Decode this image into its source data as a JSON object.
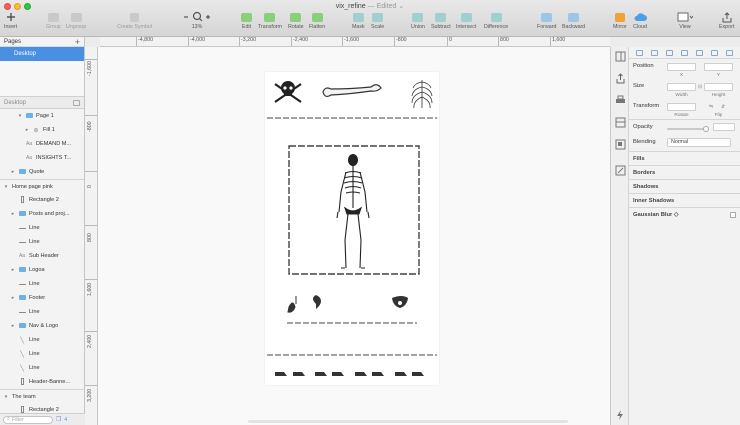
{
  "window": {
    "title": "vix_refine",
    "title_suffix": "— Edited ⌄"
  },
  "toolbar": {
    "insert": "Insert",
    "group": "Group",
    "ungroup": "Ungroup",
    "create_symbol": "Create Symbol",
    "zoom_value": "13%",
    "edit": "Edit",
    "transform": "Transform",
    "rotate": "Rotate",
    "flatten": "Flatten",
    "mask": "Mask",
    "scale": "Scale",
    "union": "Union",
    "subtract": "Subtract",
    "intersect": "Intersect",
    "difference": "Difference",
    "forward": "Forward",
    "backward": "Backward",
    "mirror": "Mirror",
    "cloud": "Cloud",
    "view": "View",
    "export": "Export"
  },
  "ruler": {
    "h_ticks": [
      "-4,800",
      "-4,000",
      "-3,200",
      "-2,400",
      "-1,600",
      "-800",
      "0",
      "800",
      "1,600"
    ],
    "v_ticks": [
      "-1,600",
      "-800",
      "0",
      "800",
      "1,600",
      "2,400",
      "3,200"
    ]
  },
  "sidebar": {
    "pages_label": "Pages",
    "page_selected": "Desktop",
    "filter_label": "Desktop",
    "search_placeholder": "Filter",
    "layer_count": "4",
    "layers": [
      {
        "name": "Page 1",
        "icon": "folder",
        "indent": 2,
        "expanded": true
      },
      {
        "name": "Fill 1",
        "icon": "shape",
        "indent": 3,
        "expanded": false
      },
      {
        "name": "DEMAND M...",
        "icon": "text",
        "indent": 2
      },
      {
        "name": "INSIGHTS T...",
        "icon": "text",
        "indent": 2
      },
      {
        "name": "Quote",
        "icon": "folder",
        "indent": 1,
        "expanded": false
      },
      {
        "name": "Home page pink",
        "icon": "artboard",
        "indent": 0,
        "expanded": true
      },
      {
        "name": "Rectangle 2",
        "icon": "rect",
        "indent": 1
      },
      {
        "name": "Posts and proj...",
        "icon": "folder",
        "indent": 1,
        "expanded": false
      },
      {
        "name": "Line",
        "icon": "line-h",
        "indent": 1
      },
      {
        "name": "Line",
        "icon": "line-h",
        "indent": 1
      },
      {
        "name": "Sub Header",
        "icon": "text",
        "indent": 1
      },
      {
        "name": "Logoa",
        "icon": "folder",
        "indent": 1,
        "expanded": false
      },
      {
        "name": "Line",
        "icon": "line-h",
        "indent": 1
      },
      {
        "name": "Footer",
        "icon": "folder",
        "indent": 1,
        "expanded": false
      },
      {
        "name": "Line",
        "icon": "line-h",
        "indent": 1
      },
      {
        "name": "Nav & Logo",
        "icon": "folder",
        "indent": 1,
        "expanded": false
      },
      {
        "name": "Line",
        "icon": "line-d",
        "indent": 1
      },
      {
        "name": "Line",
        "icon": "line-d",
        "indent": 1
      },
      {
        "name": "Line",
        "icon": "line-d",
        "indent": 1
      },
      {
        "name": "Header-Banne...",
        "icon": "rect",
        "indent": 1
      },
      {
        "name": "The team",
        "icon": "artboard",
        "indent": 0,
        "expanded": true
      },
      {
        "name": "Rectangle 2",
        "icon": "rect",
        "indent": 1
      }
    ]
  },
  "inspector": {
    "position": "Position",
    "x": "X",
    "y": "Y",
    "size": "Size",
    "width": "Width",
    "height": "Height",
    "transform": "Transform",
    "rotate": "Rotate",
    "flip": "Flip",
    "opacity": "Opacity",
    "blending": "Blending",
    "blending_value": "Normal",
    "fills": "Fills",
    "borders": "Borders",
    "shadows": "Shadows",
    "inner_shadows": "Inner Shadows",
    "gaussian_blur": "Gaussian Blur ◇"
  },
  "colors": {
    "selection": "#4a90e2",
    "folder": "#6fb0e8",
    "toolbar_green": "#8ad07a"
  }
}
